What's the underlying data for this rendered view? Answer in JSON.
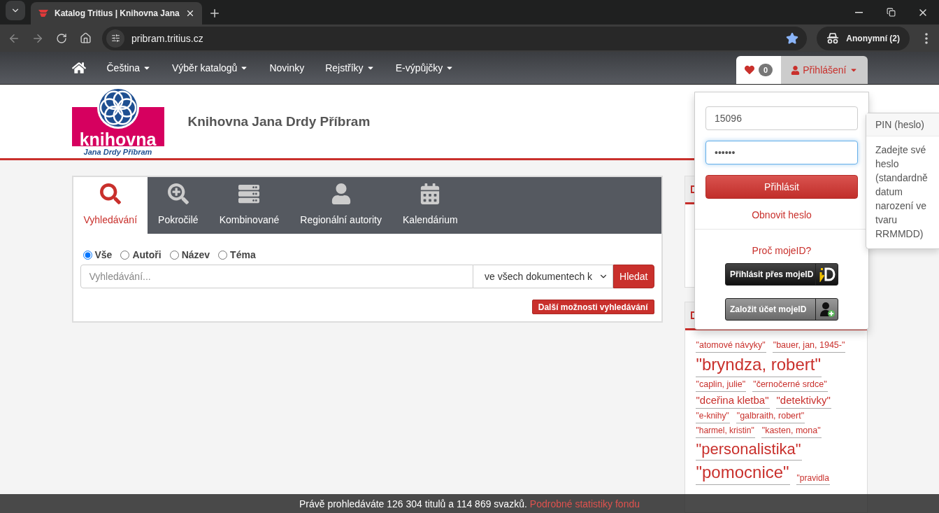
{
  "browser": {
    "tabs": [
      {
        "title": "Katalog Tritius | Knihovna Jana",
        "selected": true
      }
    ],
    "url": "pribram.tritius.cz",
    "bookmarked": true,
    "profile": "Anonymní (2)"
  },
  "navbar": {
    "items": [
      {
        "kind": "home"
      },
      {
        "kind": "dropdown",
        "label": "Čeština"
      },
      {
        "kind": "dropdown",
        "label": "Výběr katalogů"
      },
      {
        "kind": "link",
        "label": "Novinky"
      },
      {
        "kind": "dropdown",
        "label": "Rejstříky"
      },
      {
        "kind": "dropdown",
        "label": "E-výpůjčky"
      }
    ],
    "favorites_count": "0",
    "login": "Přihlášení"
  },
  "header": {
    "logo_word": "knihovna",
    "logo_subtitle": "Jana Drdy Příbram",
    "title": "Knihovna Jana Drdy Příbram"
  },
  "search": {
    "tabs": [
      {
        "kind": "search",
        "label": "Vyhledávání",
        "selected": true
      },
      {
        "kind": "advanced",
        "label": "Pokročilé",
        "selected": false
      },
      {
        "kind": "combined",
        "label": "Kombinované",
        "selected": false
      },
      {
        "kind": "authority",
        "label": "Regionální autority",
        "selected": false
      },
      {
        "kind": "calendar",
        "label": "Kalendárium",
        "selected": false
      }
    ],
    "scopes": [
      {
        "label": "Vše",
        "selected": true
      },
      {
        "label": "Autoři",
        "selected": false
      },
      {
        "label": "Název",
        "selected": false
      },
      {
        "label": "Téma",
        "selected": false
      }
    ],
    "placeholder": "Vyhledávání...",
    "select": "ve všech dokumentech k",
    "button": "Hledat",
    "more": "Další možnosti vyhledávání"
  },
  "login_dropdown": {
    "username": "15096",
    "password": "••••••",
    "submit": "Přihlásit",
    "reset": "Obnovit heslo",
    "mojeid_link": "Proč mojeID?",
    "mojeid_buttons": [
      {
        "kind": "login",
        "label": "Přihlásit přes mojeID"
      },
      {
        "kind": "register",
        "label": "Založit účet mojeID"
      }
    ]
  },
  "tooltip": {
    "title": "PIN (heslo)",
    "body": "Zadejte své heslo (standardně datum narození ve tvaru RRMMDD)"
  },
  "tag_cloud": {
    "tags": [
      {
        "text": "\"atomové návyky\"",
        "kind": "small"
      },
      {
        "text": "\"bauer, jan, 1945-\"",
        "kind": "small"
      },
      {
        "text": "\"bryndza, robert\"",
        "kind": "huge"
      },
      {
        "text": "\"caplin, julie\"",
        "kind": "small"
      },
      {
        "text": "\"černočerné srdce\"",
        "kind": "small"
      },
      {
        "text": "\"dceřina kletba\"",
        "kind": "medium"
      },
      {
        "text": "\"detektivky\"",
        "kind": "medium"
      },
      {
        "text": "\"e-knihy\"",
        "kind": "tiny"
      },
      {
        "text": "\"galbraith, robert\"",
        "kind": "small"
      },
      {
        "text": "\"harmel, kristin\"",
        "kind": "tiny"
      },
      {
        "text": "\"kasten, mona\"",
        "kind": "small"
      },
      {
        "text": "\"personalistika\"",
        "kind": "large"
      },
      {
        "text": "\"pomocnice\"",
        "kind": "huge"
      },
      {
        "text": "\"pravidla",
        "kind": "tiny"
      }
    ]
  },
  "status_bar": {
    "text": "Právě prohledáváte 126 304 titulů a 114 869 svazků.",
    "link": "Podrobné statistiky fondu"
  }
}
